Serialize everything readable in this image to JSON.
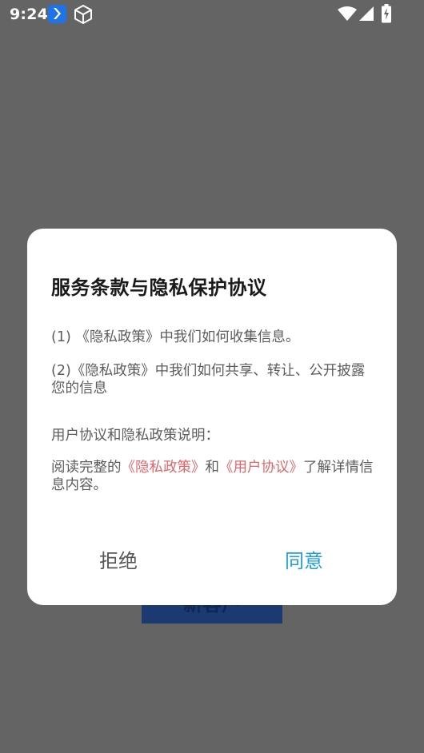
{
  "status_bar": {
    "time": "9:24",
    "icons": [
      "app-icon",
      "cube-icon",
      "wifi-icon",
      "signal-icon",
      "battery-charging-icon"
    ]
  },
  "background": {
    "button_label": "新客户"
  },
  "dialog": {
    "title": "服务条款与隐私保护协议",
    "item1": "(1) 《隐私政策》中我们如何收集信息。",
    "item2": "(2)《隐私政策》中我们如何共享、转让、公开披露您的信息",
    "section_heading": "用户协议和隐私政策说明：",
    "read_prefix": "阅读完整的",
    "privacy_link": "《隐私政策》",
    "and_text": "和",
    "user_agreement_link": "《用户协议》",
    "read_suffix": "了解详情信息内容。",
    "reject_label": "拒绝",
    "agree_label": "同意"
  },
  "colors": {
    "overlay": "#646464",
    "link": "#e0656b",
    "agree": "#1e9de0",
    "reject": "#555555"
  }
}
